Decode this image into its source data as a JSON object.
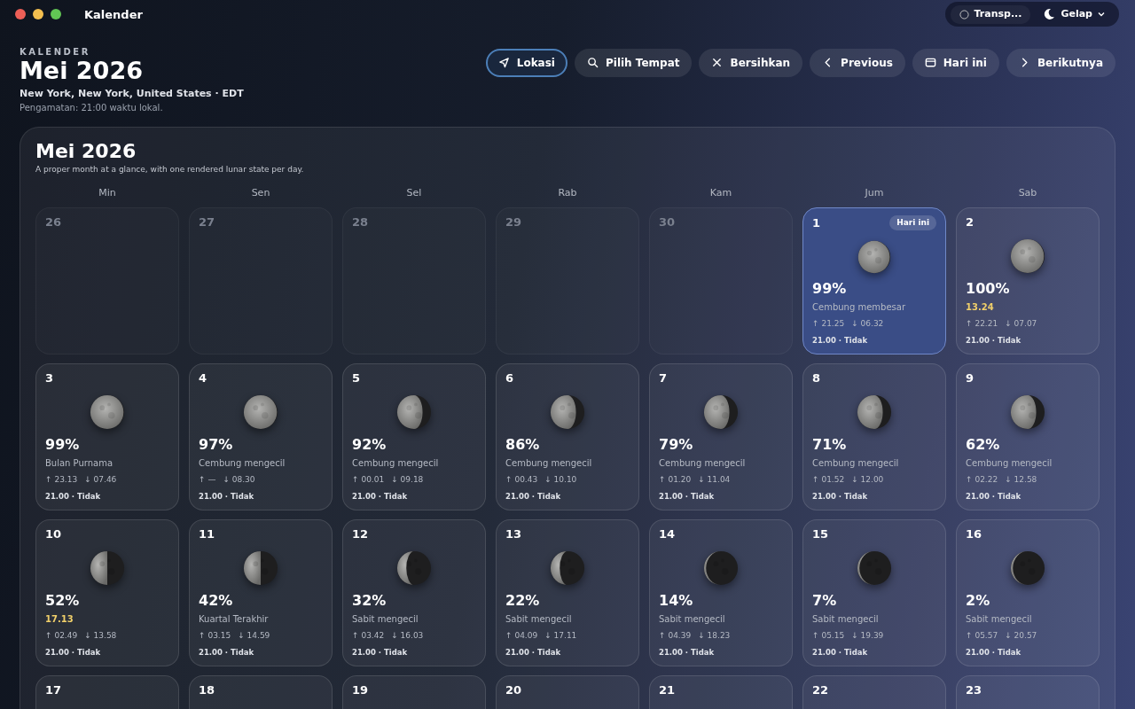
{
  "window": {
    "title": "Kalender"
  },
  "toolbar": {
    "transparency": "Transp...",
    "theme": "Gelap"
  },
  "header": {
    "eyebrow": "KALENDER",
    "title": "Mei 2026",
    "location": "New York, New York, United States · EDT",
    "observation": "Pengamatan: 21:00 waktu lokal."
  },
  "actions": [
    {
      "kind": "location",
      "label": "Lokasi",
      "selected": true
    },
    {
      "kind": "search",
      "label": "Pilih Tempat",
      "selected": false
    },
    {
      "kind": "clear",
      "label": "Bersihkan",
      "selected": false
    },
    {
      "kind": "prev",
      "label": "Previous",
      "selected": false
    },
    {
      "kind": "today",
      "label": "Hari ini",
      "selected": false
    },
    {
      "kind": "next",
      "label": "Berikutnya",
      "selected": false
    }
  ],
  "panel": {
    "title": "Mei 2026",
    "subtitle": "A proper month at a glance, with one rendered lunar state per day.",
    "weekdays": [
      "Min",
      "Sen",
      "Sel",
      "Rab",
      "Kam",
      "Jum",
      "Sab"
    ],
    "days": [
      {
        "day": "26",
        "outside": true,
        "today": false
      },
      {
        "day": "27",
        "outside": true,
        "today": false
      },
      {
        "day": "28",
        "outside": true,
        "today": false
      },
      {
        "day": "29",
        "outside": true,
        "today": false
      },
      {
        "day": "30",
        "outside": true,
        "today": false
      },
      {
        "day": "1",
        "outside": false,
        "today": true,
        "badge": "Hari ini",
        "kind": "full",
        "illumination": "99%",
        "note": "Cembung membesar",
        "highlight": false,
        "rise": "↑ 21.25",
        "set": "↓ 06.32",
        "observe": "21.00 · Tidak"
      },
      {
        "day": "2",
        "outside": false,
        "today": false,
        "kind": "full",
        "illumination": "100%",
        "note": "13.24",
        "highlight": true,
        "rise": "↑ 22.21",
        "set": "↓ 07.07",
        "observe": "21.00 · Tidak"
      },
      {
        "day": "3",
        "outside": false,
        "today": false,
        "kind": "full",
        "illumination": "99%",
        "note": "Bulan Purnama",
        "highlight": false,
        "rise": "↑ 23.13",
        "set": "↓ 07.46",
        "observe": "21.00 · Tidak"
      },
      {
        "day": "4",
        "outside": false,
        "today": false,
        "kind": "full",
        "illumination": "97%",
        "note": "Cembung mengecil",
        "highlight": false,
        "rise": "↑ —",
        "set": "↓ 08.30",
        "observe": "21.00 · Tidak"
      },
      {
        "day": "5",
        "outside": false,
        "today": false,
        "kind": "gibbous",
        "illumination": "92%",
        "note": "Cembung mengecil",
        "highlight": false,
        "rise": "↑ 00.01",
        "set": "↓ 09.18",
        "observe": "21.00 · Tidak"
      },
      {
        "day": "6",
        "outside": false,
        "today": false,
        "kind": "gibbous",
        "illumination": "86%",
        "note": "Cembung mengecil",
        "highlight": false,
        "rise": "↑ 00.43",
        "set": "↓ 10.10",
        "observe": "21.00 · Tidak"
      },
      {
        "day": "7",
        "outside": false,
        "today": false,
        "kind": "gibbous",
        "illumination": "79%",
        "note": "Cembung mengecil",
        "highlight": false,
        "rise": "↑ 01.20",
        "set": "↓ 11.04",
        "observe": "21.00 · Tidak"
      },
      {
        "day": "8",
        "outside": false,
        "today": false,
        "kind": "gibbous",
        "illumination": "71%",
        "note": "Cembung mengecil",
        "highlight": false,
        "rise": "↑ 01.52",
        "set": "↓ 12.00",
        "observe": "21.00 · Tidak"
      },
      {
        "day": "9",
        "outside": false,
        "today": false,
        "kind": "gibbous",
        "illumination": "62%",
        "note": "Cembung mengecil",
        "highlight": false,
        "rise": "↑ 02.22",
        "set": "↓ 12.58",
        "observe": "21.00 · Tidak"
      },
      {
        "day": "10",
        "outside": false,
        "today": false,
        "kind": "half",
        "illumination": "52%",
        "note": "17.13",
        "highlight": true,
        "rise": "↑ 02.49",
        "set": "↓ 13.58",
        "observe": "21.00 · Tidak"
      },
      {
        "day": "11",
        "outside": false,
        "today": false,
        "kind": "half",
        "illumination": "42%",
        "note": "Kuartal Terakhir",
        "highlight": false,
        "rise": "↑ 03.15",
        "set": "↓ 14.59",
        "observe": "21.00 · Tidak"
      },
      {
        "day": "12",
        "outside": false,
        "today": false,
        "kind": "crescent",
        "illumination": "32%",
        "note": "Sabit mengecil",
        "highlight": false,
        "rise": "↑ 03.42",
        "set": "↓ 16.03",
        "observe": "21.00 · Tidak"
      },
      {
        "day": "13",
        "outside": false,
        "today": false,
        "kind": "crescent",
        "illumination": "22%",
        "note": "Sabit mengecil",
        "highlight": false,
        "rise": "↑ 04.09",
        "set": "↓ 17.11",
        "observe": "21.00 · Tidak"
      },
      {
        "day": "14",
        "outside": false,
        "today": false,
        "kind": "dark",
        "illumination": "14%",
        "note": "Sabit mengecil",
        "highlight": false,
        "rise": "↑ 04.39",
        "set": "↓ 18.23",
        "observe": "21.00 · Tidak"
      },
      {
        "day": "15",
        "outside": false,
        "today": false,
        "kind": "dark",
        "illumination": "7%",
        "note": "Sabit mengecil",
        "highlight": false,
        "rise": "↑ 05.15",
        "set": "↓ 19.39",
        "observe": "21.00 · Tidak"
      },
      {
        "day": "16",
        "outside": false,
        "today": false,
        "kind": "dark",
        "illumination": "2%",
        "note": "Sabit mengecil",
        "highlight": false,
        "rise": "↑ 05.57",
        "set": "↓ 20.57",
        "observe": "21.00 · Tidak"
      },
      {
        "day": "17",
        "outside": false,
        "today": false
      },
      {
        "day": "18",
        "outside": false,
        "today": false
      },
      {
        "day": "19",
        "outside": false,
        "today": false
      },
      {
        "day": "20",
        "outside": false,
        "today": false
      },
      {
        "day": "21",
        "outside": false,
        "today": false
      },
      {
        "day": "22",
        "outside": false,
        "today": false
      },
      {
        "day": "23",
        "outside": false,
        "today": false
      }
    ]
  }
}
